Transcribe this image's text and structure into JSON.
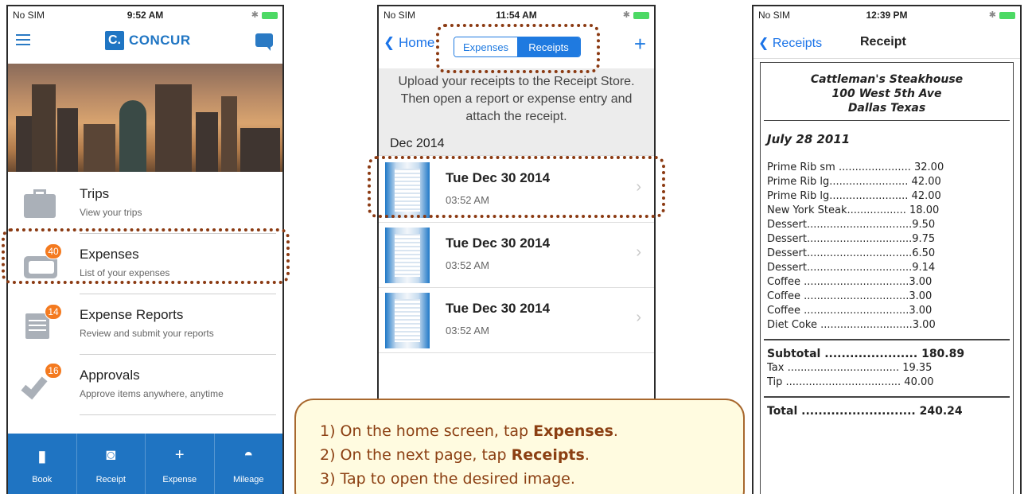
{
  "phone1": {
    "status": {
      "carrier": "No SIM",
      "time": "9:52 AM"
    },
    "logo_letter": "C.",
    "logo_text": "CONCUR",
    "menu": [
      {
        "title": "Trips",
        "subtitle": "View your trips",
        "badge": ""
      },
      {
        "title": "Expenses",
        "subtitle": "List of your expenses",
        "badge": "40"
      },
      {
        "title": "Expense Reports",
        "subtitle": "Review and submit your reports",
        "badge": "14"
      },
      {
        "title": "Approvals",
        "subtitle": "Approve items anywhere, anytime",
        "badge": "16"
      }
    ],
    "tabs": [
      {
        "label": "Book",
        "icon": "briefcase-icon"
      },
      {
        "label": "Receipt",
        "icon": "camera-icon"
      },
      {
        "label": "Expense",
        "icon": "plus-icon"
      },
      {
        "label": "Mileage",
        "icon": "gauge-icon"
      }
    ]
  },
  "phone2": {
    "status": {
      "carrier": "No SIM",
      "time": "11:54 AM"
    },
    "back_label": "Home",
    "segments": [
      "Expenses",
      "Receipts"
    ],
    "info": "Upload your receipts to the Receipt Store. Then open a report or expense entry and attach the receipt.",
    "section": "Dec 2014",
    "receipts": [
      {
        "title": "Tue Dec 30 2014",
        "time": "03:52 AM"
      },
      {
        "title": "Tue Dec 30 2014",
        "time": "03:52 AM"
      },
      {
        "title": "Tue Dec 30 2014",
        "time": "03:52 AM"
      }
    ]
  },
  "phone3": {
    "status": {
      "carrier": "No SIM",
      "time": "12:39 PM"
    },
    "back_label": "Receipts",
    "title": "Receipt",
    "store": [
      "Cattleman's Steakhouse",
      "100 West 5th Ave",
      "Dallas Texas"
    ],
    "date": "July 28 2011",
    "items": [
      "Prime Rib sm ...................... 32.00",
      "Prime Rib lg........................ 42.00",
      "Prime Rib lg........................ 42.00",
      "New York Steak.................. 18.00",
      "Dessert................................9.50",
      "Dessert................................9.75",
      "Dessert................................6.50",
      "Dessert................................9.14",
      "Coffee ................................3.00",
      "Coffee ................................3.00",
      "Coffee ................................3.00",
      "Diet Coke ............................3.00"
    ],
    "subtotal": "Subtotal ...................... 180.89",
    "tax": "Tax .................................. 19.35",
    "tip": "Tip ................................... 40.00",
    "total": "Total ........................... 240.24"
  },
  "callout": {
    "line1_prefix": "1) On the home screen, tap ",
    "line1_bold": "Expenses",
    "line1_suffix": ".",
    "line2_prefix": "2) On the next page, tap ",
    "line2_bold": "Receipts",
    "line2_suffix": ".",
    "line3": "3) Tap to open the desired image."
  },
  "colors": {
    "brand_blue": "#1f74c2",
    "badge_orange": "#f47a1f",
    "highlight_brown": "#8b3a12"
  }
}
